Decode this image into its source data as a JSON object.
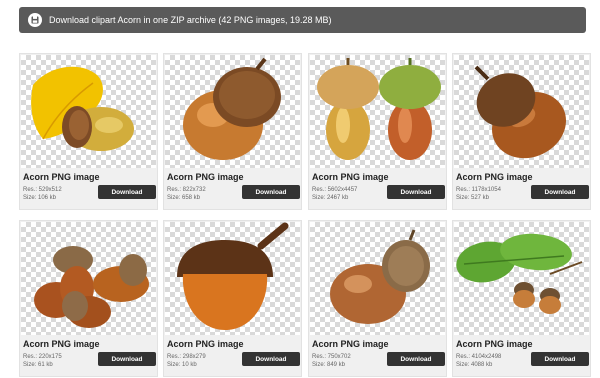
{
  "zip_bar": {
    "text": "Download clipart Acorn in one ZIP archive (42 PNG images, 19.28 MB)",
    "icon": "floppy-disk-icon"
  },
  "cards": [
    {
      "title": "Acorn PNG image",
      "res": "Res.: 529x512",
      "size": "Size: 106 kb",
      "button": "Download"
    },
    {
      "title": "Acorn PNG image",
      "res": "Res.: 822x732",
      "size": "Size: 658 kb",
      "button": "Download"
    },
    {
      "title": "Acorn PNG image",
      "res": "Res.: 5602x4457",
      "size": "Size: 2467 kb",
      "button": "Download"
    },
    {
      "title": "Acorn PNG image",
      "res": "Res.: 1178x1054",
      "size": "Size: 527 kb",
      "button": "Download"
    },
    {
      "title": "Acorn PNG image",
      "res": "Res.: 220x175",
      "size": "Size: 61 kb",
      "button": "Download"
    },
    {
      "title": "Acorn PNG image",
      "res": "Res.: 298x279",
      "size": "Size: 10 kb",
      "button": "Download"
    },
    {
      "title": "Acorn PNG image",
      "res": "Res.: 750x702",
      "size": "Size: 849 kb",
      "button": "Download"
    },
    {
      "title": "Acorn PNG image",
      "res": "Res.: 4104x2498",
      "size": "Size: 4088 kb",
      "button": "Download"
    }
  ]
}
